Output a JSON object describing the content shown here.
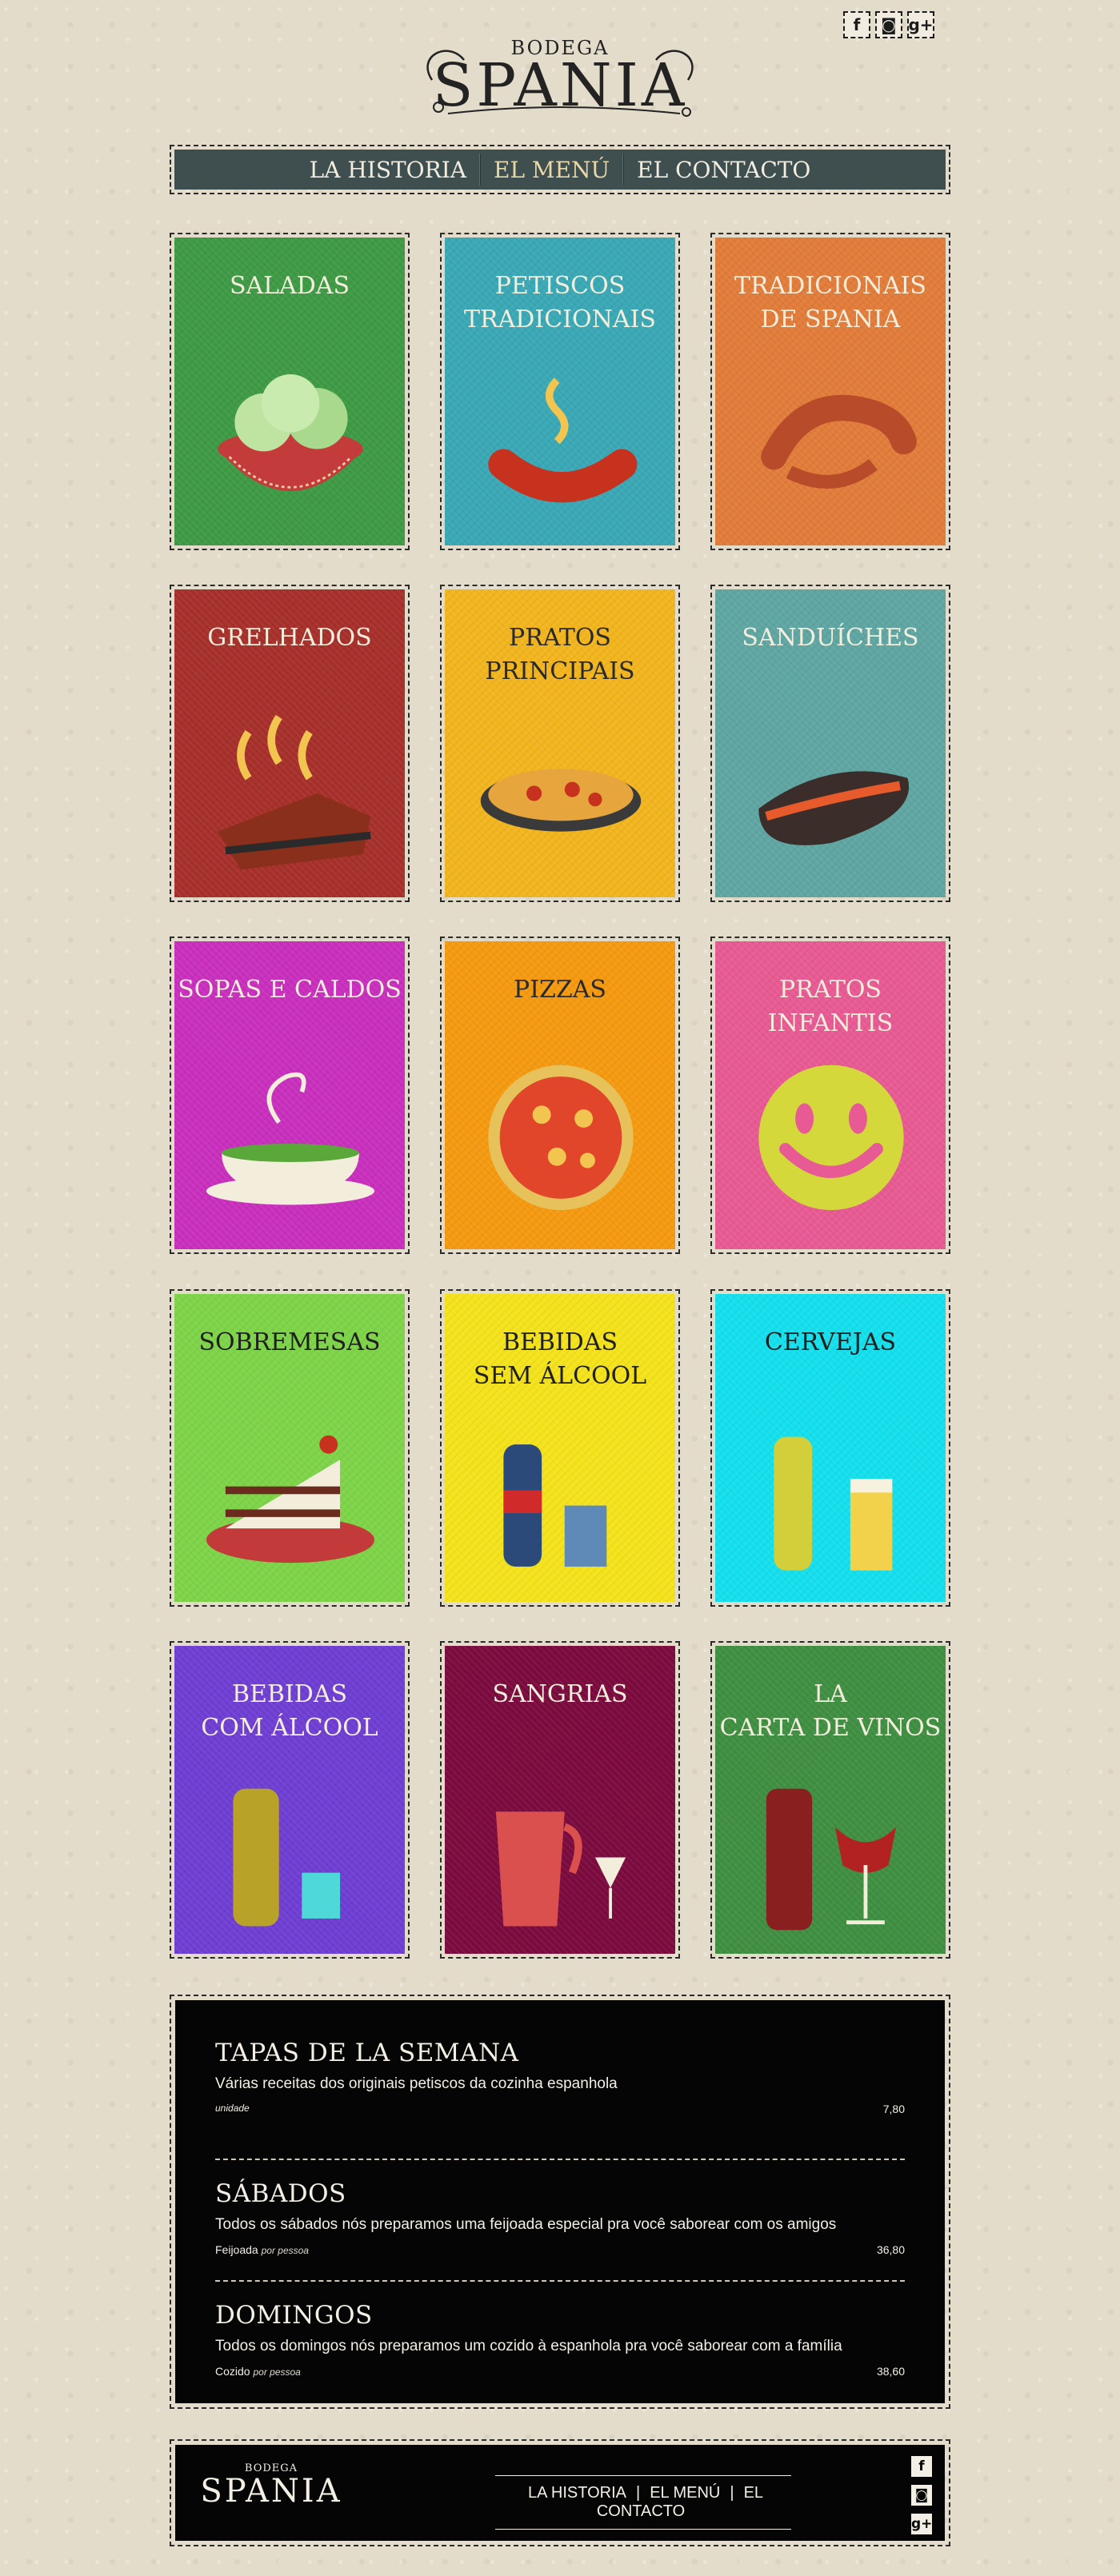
{
  "header": {
    "logo_small": "BODEGA",
    "logo_big": "SPANIA",
    "social": [
      {
        "icon": "facebook-icon",
        "glyph": "f"
      },
      {
        "icon": "instagram-icon",
        "glyph": "◙"
      },
      {
        "icon": "google-plus-icon",
        "glyph": "g+"
      }
    ]
  },
  "nav": {
    "items": [
      {
        "label": "LA HISTORIA",
        "active": false
      },
      {
        "label": "EL MENÚ",
        "active": true
      },
      {
        "label": "EL CONTACTO",
        "active": false
      }
    ]
  },
  "menu_cards": [
    {
      "title": "SALADAS",
      "bg": "#3e9a45",
      "text": "#f3eddc",
      "icon": "salad-bowl-icon"
    },
    {
      "title": "PETISCOS\nTRADICIONAIS",
      "bg": "#3aa8b5",
      "text": "#f3eddc",
      "icon": "sausage-icon"
    },
    {
      "title": "TRADICIONAIS\nDE SPANIA",
      "bg": "#e27c3a",
      "text": "#f3eddc",
      "icon": "shrimp-icon"
    },
    {
      "title": "GRELHADOS",
      "bg": "#a7302b",
      "text": "#f3eddc",
      "icon": "steak-icon"
    },
    {
      "title": "PRATOS\nPRINCIPAIS",
      "bg": "#f2b51e",
      "text": "#2a2a2a",
      "icon": "paella-icon"
    },
    {
      "title": "SANDUÍCHES",
      "bg": "#5fa6a3",
      "text": "#f3eddc",
      "icon": "sandwich-icon"
    },
    {
      "title": "SOPAS E CALDOS",
      "bg": "#c92fbd",
      "text": "#f3eddc",
      "icon": "soup-icon"
    },
    {
      "title": "PIZZAS",
      "bg": "#f59a10",
      "text": "#2a2a2a",
      "icon": "pizza-icon"
    },
    {
      "title": "PRATOS\nINFANTIS",
      "bg": "#e85a93",
      "text": "#f3eddc",
      "icon": "smiley-icon"
    },
    {
      "title": "SOBREMESAS",
      "bg": "#7ed448",
      "text": "#1f1f1f",
      "icon": "cake-icon"
    },
    {
      "title": "BEBIDAS\nSEM ÁLCOOL",
      "bg": "#f4e31b",
      "text": "#1f1f1f",
      "icon": "soda-icon"
    },
    {
      "title": "CERVEJAS",
      "bg": "#14e0ed",
      "text": "#1f1f1f",
      "icon": "beer-icon"
    },
    {
      "title": "BEBIDAS\nCOM ÁLCOOL",
      "bg": "#6f3ed3",
      "text": "#f3eddc",
      "icon": "liquor-bottle-icon"
    },
    {
      "title": "SANGRIAS",
      "bg": "#7b0b3e",
      "text": "#f3eddc",
      "icon": "sangria-pitcher-icon"
    },
    {
      "title": "LA\nCARTA DE VINOS",
      "bg": "#3f8f42",
      "text": "#f3eddc",
      "icon": "wine-icon"
    }
  ],
  "specials": [
    {
      "title": "TAPAS DE LA SEMANA",
      "description": "Várias receitas dos originais petiscos da cozinha espanhola",
      "item": "",
      "unit": "unidade",
      "price": "7,80"
    },
    {
      "title": "SÁBADOS",
      "description": "Todos os sábados nós preparamos uma feijoada especial pra você saborear com os amigos",
      "item": "Feijoada",
      "unit": "por pessoa",
      "price": "36,80"
    },
    {
      "title": "DOMINGOS",
      "description": "Todos os domingos nós preparamos um cozido à espanhola pra você saborear com a família",
      "item": "Cozido",
      "unit": "por pessoa",
      "price": "38,60"
    }
  ],
  "footer": {
    "logo_small": "BODEGA",
    "logo_big": "SPANIA",
    "nav": [
      "LA HISTORIA",
      "EL MENÚ",
      "EL CONTACTO"
    ],
    "separator": "|"
  }
}
